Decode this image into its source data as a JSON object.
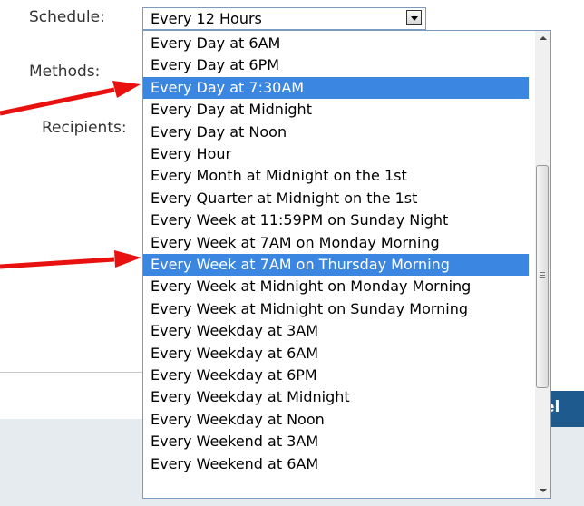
{
  "form": {
    "schedule_label": "Schedule:",
    "methods_label": "Methods:",
    "recipients_label": "Recipients:",
    "schedule_value": "Every 12 Hours"
  },
  "dropdown": {
    "items": [
      "Every Day at 6AM",
      "Every Day at 6PM",
      "Every Day at 7:30AM",
      "Every Day at Midnight",
      "Every Day at Noon",
      "Every Hour",
      "Every Month at Midnight on the 1st",
      "Every Quarter at Midnight on the 1st",
      "Every Week at 11:59PM on Sunday Night",
      "Every Week at 7AM on Monday Morning",
      "Every Week at 7AM on Thursday Morning",
      "Every Week at Midnight on Monday Morning",
      "Every Week at Midnight on Sunday Morning",
      "Every Weekday at 3AM",
      "Every Weekday at 6AM",
      "Every Weekday at 6PM",
      "Every Weekday at Midnight",
      "Every Weekday at Noon",
      "Every Weekend at 3AM",
      "Every Weekend at 6AM"
    ],
    "highlighted_items": [
      "Every Day at 7:30AM",
      "Every Week at 7AM on Thursday Morning"
    ]
  },
  "footer": {
    "button_label_partial": "el"
  },
  "colors": {
    "highlight": "#3b86e0",
    "annotation_arrow": "#e8110f",
    "footer_bg": "#e6ebf0",
    "button_bg": "#1e5a8e"
  }
}
